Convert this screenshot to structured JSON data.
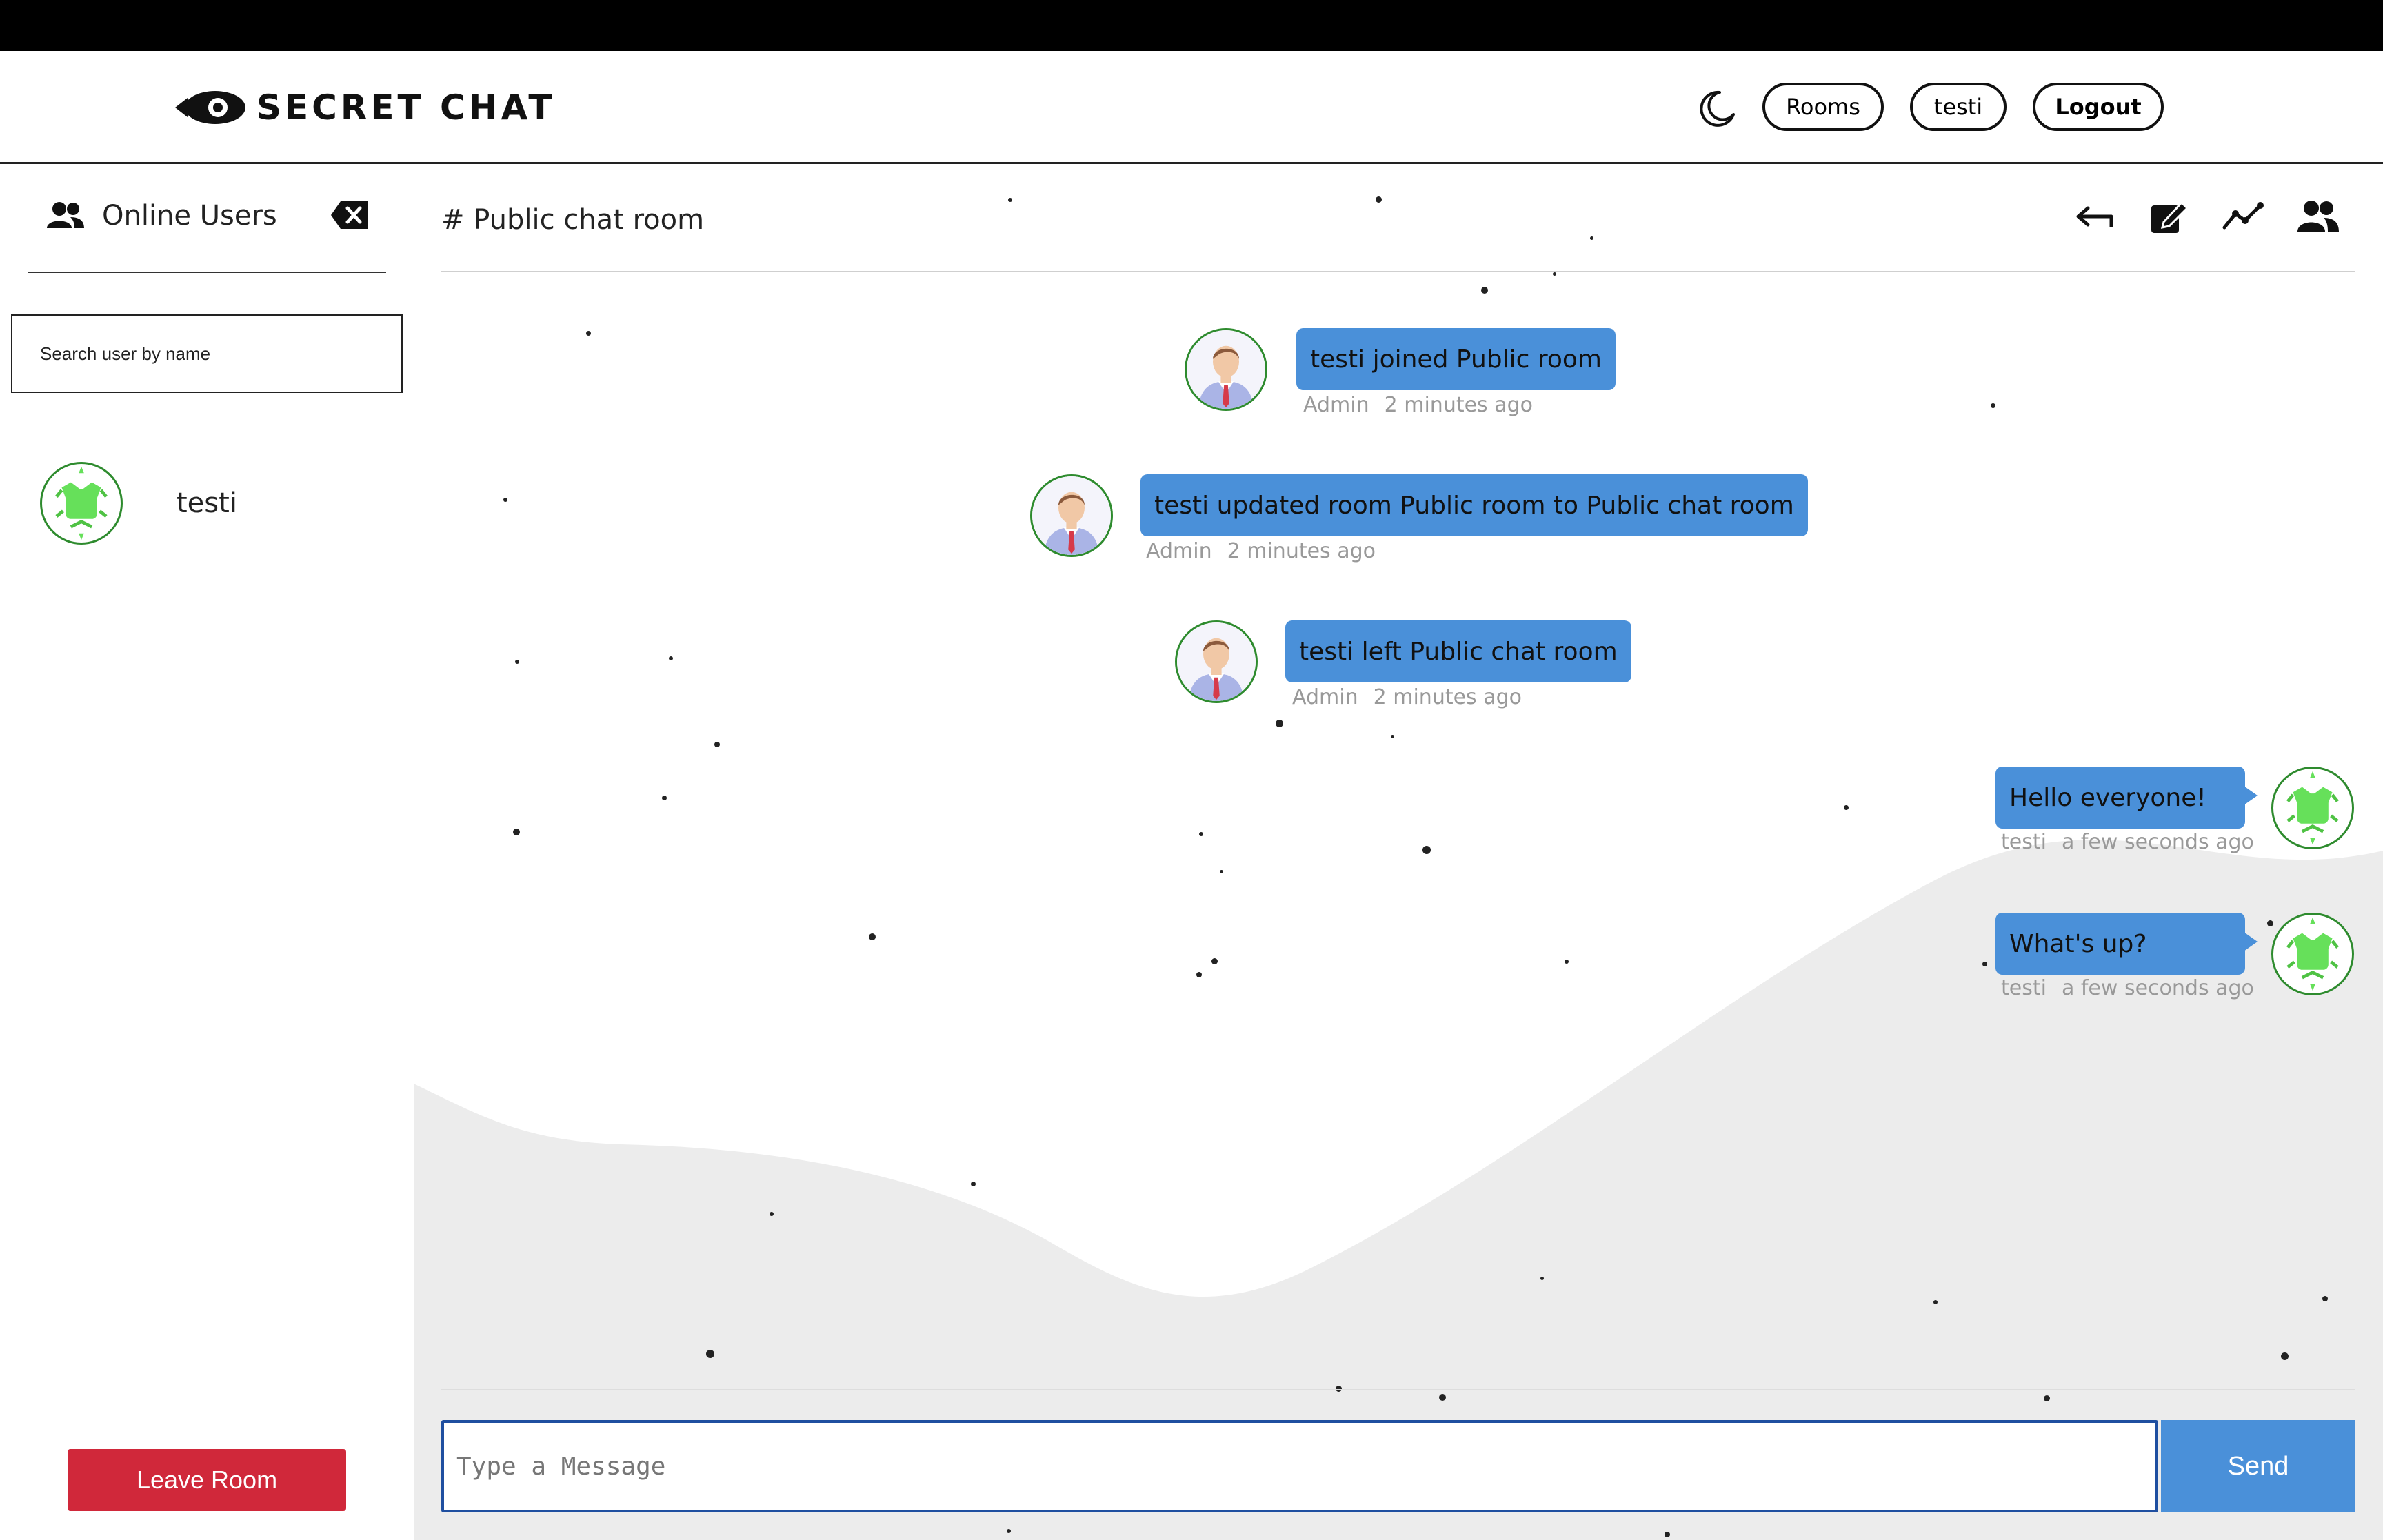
{
  "header": {
    "brand": "SECRET CHAT",
    "nav": {
      "rooms": "Rooms",
      "user": "testi",
      "logout": "Logout"
    }
  },
  "icons": {
    "brand": "rocket-eye-icon",
    "theme": "moon-icon",
    "online": "users-icon",
    "close": "backspace-x-icon",
    "back": "back-arrow-icon",
    "edit": "edit-icon",
    "stats": "chart-line-icon",
    "members": "users-icon"
  },
  "sidebar": {
    "title": "Online Users",
    "search_placeholder": "Search user by name",
    "users": [
      {
        "name": "testi"
      }
    ],
    "leave_label": "Leave Room"
  },
  "room": {
    "title": "# Public chat room"
  },
  "messages": [
    {
      "text": "testi joined Public room",
      "author": "Admin",
      "time": "2 minutes ago"
    },
    {
      "text": "testi updated room Public room to Public chat room",
      "author": "Admin",
      "time": "2 minutes ago"
    },
    {
      "text": "testi left Public chat room",
      "author": "Admin",
      "time": "2 minutes ago"
    },
    {
      "text": "Hello everyone!",
      "author": "testi",
      "time": "a few seconds ago"
    },
    {
      "text": "What's up?",
      "author": "testi",
      "time": "a few seconds ago"
    }
  ],
  "composer": {
    "placeholder": "Type a Message",
    "send_label": "Send"
  },
  "colors": {
    "bubble": "#4a90d9",
    "leave": "#d0283a",
    "avatar_border": "#2e8b2e",
    "wave": "#ececec",
    "topbar": "#000000"
  }
}
